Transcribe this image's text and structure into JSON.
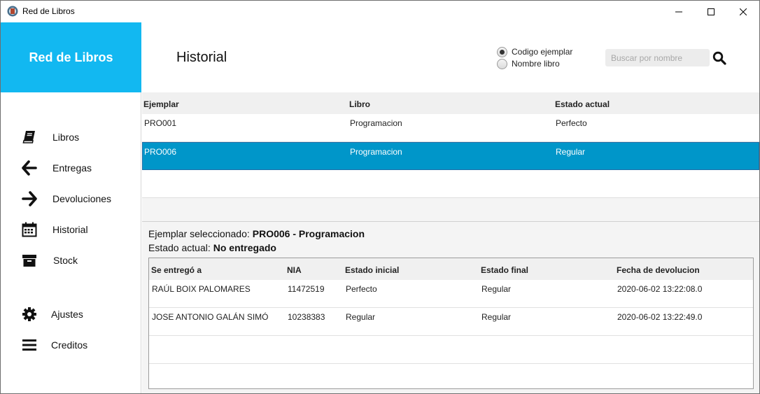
{
  "window": {
    "title": "Red de Libros"
  },
  "sidebar": {
    "brand": "Red de Libros",
    "items": [
      {
        "label": "Libros",
        "icon": "book-icon"
      },
      {
        "label": "Entregas",
        "icon": "arrow-left-icon"
      },
      {
        "label": "Devoluciones",
        "icon": "arrow-right-icon"
      },
      {
        "label": "Historial",
        "icon": "calendar-icon"
      },
      {
        "label": "Stock",
        "icon": "archive-box-icon"
      },
      {
        "label": "Ajustes",
        "icon": "gear-icon"
      },
      {
        "label": "Creditos",
        "icon": "menu-bars-icon"
      }
    ]
  },
  "header": {
    "title": "Historial",
    "radio_options": [
      {
        "label": "Codigo ejemplar",
        "checked": true
      },
      {
        "label": "Nombre libro",
        "checked": false
      }
    ],
    "search_placeholder": "Buscar por nombre",
    "search_value": ""
  },
  "copies_table": {
    "columns": [
      "Ejemplar",
      "Libro",
      "Estado actual"
    ],
    "rows": [
      {
        "ejemplar": "PRO001",
        "libro": "Programacion",
        "estado": "Perfecto",
        "selected": false
      },
      {
        "ejemplar": "PRO006",
        "libro": "Programacion",
        "estado": "Regular",
        "selected": true
      }
    ]
  },
  "detail": {
    "selected_label": "Ejemplar seleccionado:",
    "selected_value": "PRO006 - Programacion",
    "state_label": "Estado actual:",
    "state_value": "No entregado"
  },
  "history_table": {
    "columns": [
      "Se entregó a",
      "NIA",
      "Estado inicial",
      "Estado final",
      "Fecha de devolucion"
    ],
    "rows": [
      {
        "nombre": "RAÚL BOIX PALOMARES",
        "nia": "11472519",
        "inicial": "Perfecto",
        "final": "Regular",
        "fecha": "2020-06-02 13:22:08.0"
      },
      {
        "nombre": "JOSE ANTONIO GALÁN SIMÓ",
        "nia": "10238383",
        "inicial": "Regular",
        "final": "Regular",
        "fecha": "2020-06-02 13:22:49.0"
      }
    ]
  },
  "colors": {
    "brand": "#12b8f1",
    "selection": "#0096c9"
  }
}
